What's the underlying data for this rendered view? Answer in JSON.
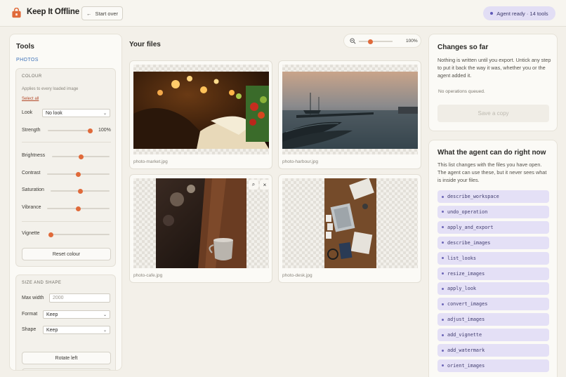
{
  "app": {
    "brand": "Keep It Offline",
    "start_over": "Start over",
    "agent_status": "Agent ready · 14 tools"
  },
  "tools_panel": {
    "title": "Tools",
    "tab": "PHOTOS",
    "colour": {
      "heading": "COLOUR",
      "hint": "Applies to every loaded image",
      "select_all": "Select all",
      "look_label": "Look",
      "look_value": "No look",
      "strength_label": "Strength",
      "strength_value": "100%",
      "strength_level": 1.0,
      "brightness_label": "Brightness",
      "brightness_level": 0.5,
      "contrast_label": "Contrast",
      "contrast_level": 0.5,
      "saturation_label": "Saturation",
      "saturation_level": 0.5,
      "vibrance_label": "Vibrance",
      "vibrance_level": 0.5,
      "vignette_label": "Vignette",
      "vignette_level": 0.0,
      "reset": "Reset colour"
    },
    "size": {
      "heading": "SIZE AND SHAPE",
      "max_width_label": "Max width",
      "max_width_placeholder": "2000",
      "format_label": "Format",
      "format_value": "Keep",
      "shape_label": "Shape",
      "shape_value": "Keep",
      "rotate_left": "Rotate left"
    }
  },
  "files": {
    "title": "Your files",
    "zoom_value": "100%",
    "zoom_level": 0.35,
    "items": [
      {
        "name": "photo-market.jpg"
      },
      {
        "name": "photo-harbour.jpg"
      },
      {
        "name": "photo-cafe.jpg"
      },
      {
        "name": "photo-desk.jpg"
      }
    ]
  },
  "changes": {
    "title": "Changes so far",
    "description": "Nothing is written until you export. Untick any step to put it back the way it was, whether you or the agent added it.",
    "empty": "No operations queued.",
    "save_copy": "Save a copy"
  },
  "agent": {
    "title": "What the agent can do right now",
    "description": "This list changes with the files you have open. The agent can use these, but it never sees what is inside your files.",
    "tools": [
      "describe_workspace",
      "undo_operation",
      "apply_and_export",
      "describe_images",
      "list_looks",
      "resize_images",
      "apply_look",
      "convert_images",
      "adjust_images",
      "add_vignette",
      "add_watermark",
      "orient_images"
    ]
  },
  "colors": {
    "accent": "#e06a3a",
    "agent_chip": "#e4e0f6",
    "link": "#3e72b8"
  }
}
